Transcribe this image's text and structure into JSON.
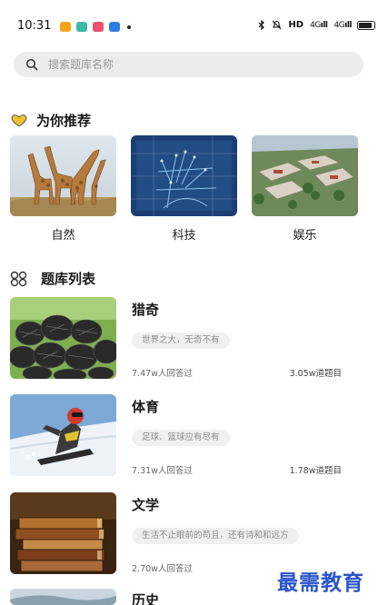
{
  "status_bar": {
    "time": "10:31",
    "indicators": "HD",
    "signal_1": "4G",
    "signal_2": "4G",
    "battery_level": 0.9
  },
  "search": {
    "placeholder": "搜索题库名称"
  },
  "recommend": {
    "title": "为你推荐",
    "items": [
      {
        "label": "自然",
        "image": "giraffes"
      },
      {
        "label": "科技",
        "image": "digital-hand"
      },
      {
        "label": "娱乐",
        "image": "resort-aerial"
      }
    ]
  },
  "library": {
    "title": "题库列表",
    "items": [
      {
        "title": "猎奇",
        "tag": "世界之大，无奇不有",
        "answered": "7.47w人回答过",
        "count": "3.05w道题目",
        "image": "pinecones"
      },
      {
        "title": "体育",
        "tag": "足球、篮球应有尽有",
        "answered": "7.31w人回答过",
        "count": "1.78w道题目",
        "image": "snowboarder"
      },
      {
        "title": "文学",
        "tag": "生活不止眼前的苟且，还有诗和和远方",
        "answered": "2.70w人回答过",
        "count": "",
        "image": "old-books"
      },
      {
        "title": "历史",
        "tag": "",
        "answered": "",
        "count": "",
        "image": "landscape"
      }
    ]
  },
  "watermark": "最需教育",
  "colors": {
    "accent_yellow": "#f2c230",
    "watermark_blue": "#2b55c9"
  }
}
